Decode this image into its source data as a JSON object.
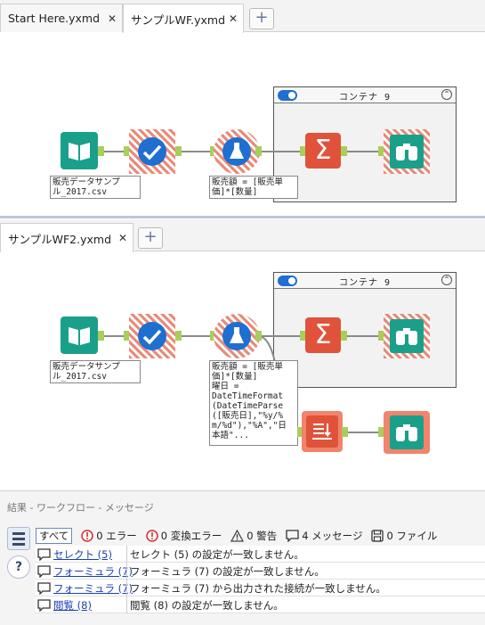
{
  "top_tabs": [
    {
      "label": "Start Here.yxmd",
      "close": "✕"
    },
    {
      "label": "サンプルWF.yxmd",
      "close": "✕"
    }
  ],
  "bottom_tabs": [
    {
      "label": "サンプルWF2.yxmd",
      "close": "✕"
    }
  ],
  "add_tab": "+",
  "workflow1": {
    "container_title": "コンテナ 9",
    "input_label": "販売データサンプ\nル_2017.csv",
    "formula_label": "販売額 = [販売単\n価]*[数量]"
  },
  "workflow2": {
    "container_title": "コンテナ 9",
    "input_label": "販売データサンプ\nル_2017.csv",
    "formula_label": "販売額 = [販売単\n価]*[数量]\n曜日 =\nDateTimeFormat\n(DateTimeParse\n([販売日],\"%y/%\nm/%d\"),\"%A\",\"日\n本語\"..."
  },
  "results": {
    "title": "結果 - ワークフロー - メッセージ",
    "filters": [
      {
        "label": "すべて",
        "icon": ""
      },
      {
        "label": "0 エラー",
        "icon": "error-icon"
      },
      {
        "label": "0 変換エラー",
        "icon": "conversion-error-icon"
      },
      {
        "label": "0 警告",
        "icon": "warning-icon"
      },
      {
        "label": "4 メッセージ",
        "icon": "message-icon"
      },
      {
        "label": "0 ファイル",
        "icon": "file-icon"
      }
    ],
    "messages": [
      {
        "tool": "セレクト (5)",
        "text": "セレクト (5) の設定が一致しません。"
      },
      {
        "tool": "フォーミュラ (7)",
        "text": "フォーミュラ (7) の設定が一致しません。"
      },
      {
        "tool": "フォーミュラ (7)",
        "text": "フォーミュラ (7) から出力された接続が一致しません。"
      },
      {
        "tool": "閲覧 (8)",
        "text": "閲覧 (8) の設定が一致しません。"
      }
    ]
  },
  "colors": {
    "input_tool": "#1aa08a",
    "select_tool": "#1f6fd1",
    "formula_tool": "#1f6fd1",
    "summarize_tool": "#e0533a",
    "browse_tool": "#1aa08a",
    "anchor": "#a8cf5a"
  }
}
